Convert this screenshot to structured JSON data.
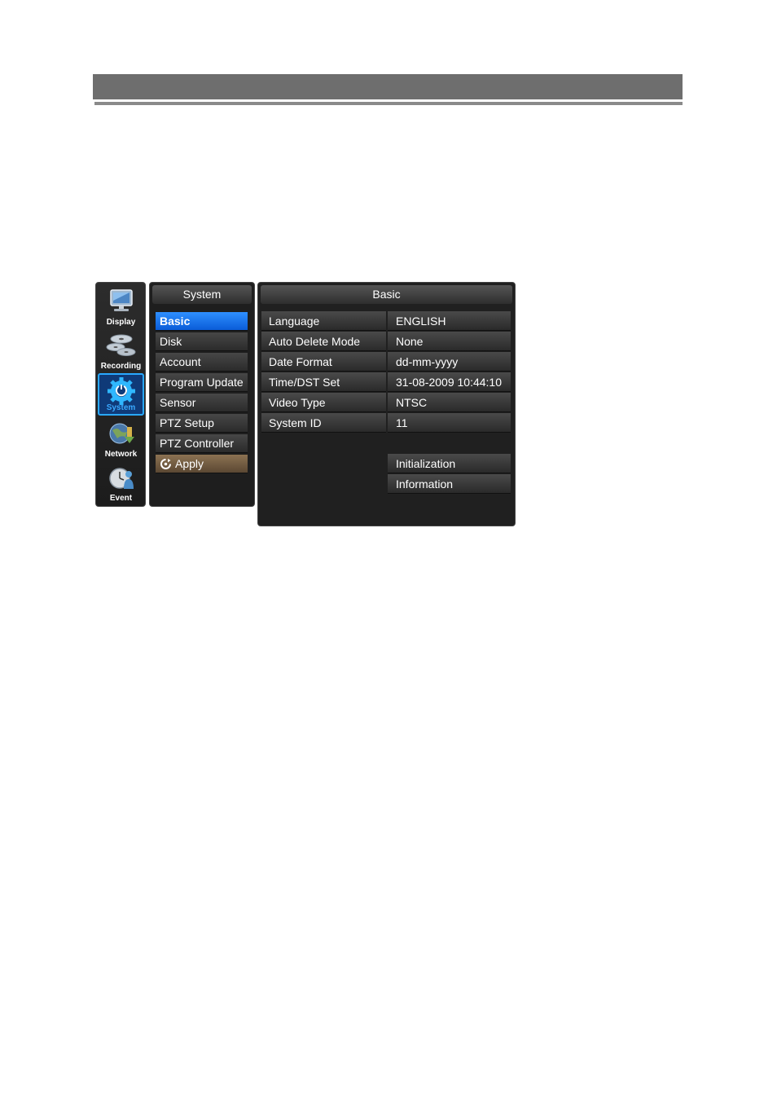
{
  "categories": [
    {
      "label": "Display",
      "icon": "monitor-icon",
      "active": false
    },
    {
      "label": "Recording",
      "icon": "disk-stack-icon",
      "active": false
    },
    {
      "label": "System",
      "icon": "gear-icon",
      "active": true
    },
    {
      "label": "Network",
      "icon": "globe-icon",
      "active": false
    },
    {
      "label": "Event",
      "icon": "clock-person-icon",
      "active": false
    }
  ],
  "submenu": {
    "title": "System",
    "items": [
      "Basic",
      "Disk",
      "Account",
      "Program Update",
      "Sensor",
      "PTZ Setup",
      "PTZ Controller"
    ],
    "selected": "Basic",
    "apply_label": "Apply"
  },
  "main": {
    "title": "Basic",
    "rows": [
      {
        "label": "Language",
        "value": "ENGLISH"
      },
      {
        "label": "Auto Delete Mode",
        "value": "None"
      },
      {
        "label": "Date Format",
        "value": "dd-mm-yyyy"
      },
      {
        "label": "Time/DST Set",
        "value": "31-08-2009 10:44:10"
      },
      {
        "label": "Video Type",
        "value": "NTSC"
      },
      {
        "label": "System ID",
        "value": "11"
      }
    ],
    "buttons": {
      "initialization": "Initialization",
      "information": "Information"
    }
  },
  "colors": {
    "selected": "#1a74f0",
    "apply": "#7a6246",
    "active_border": "#29a8ff"
  }
}
